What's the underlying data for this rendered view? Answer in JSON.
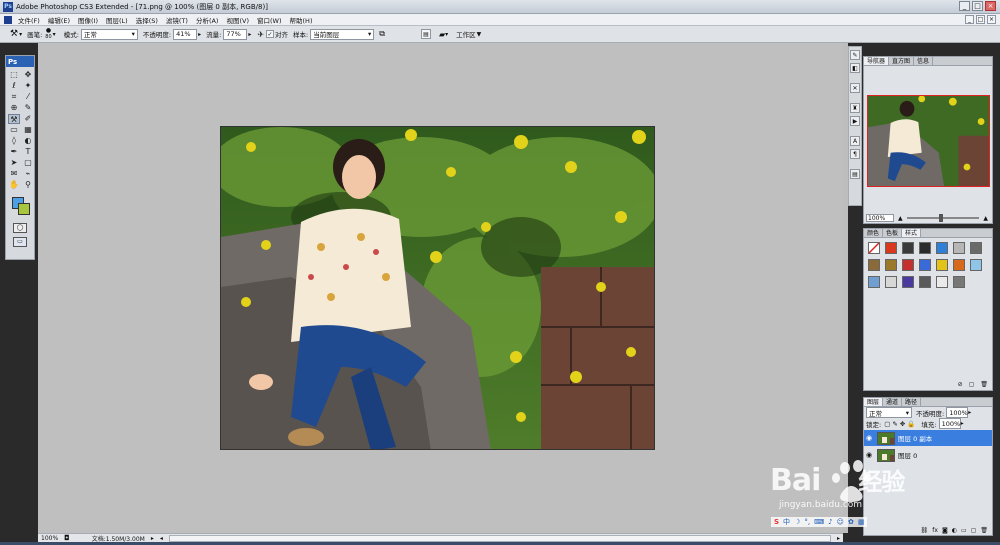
{
  "window": {
    "title": "Adobe Photoshop CS3 Extended - [71.png @ 100% (图层 0 副本, RGB/8)]",
    "app_icon": "Ps",
    "controls": [
      "_",
      "□",
      "×"
    ]
  },
  "menu": {
    "items": [
      "文件(F)",
      "编辑(E)",
      "图像(I)",
      "图层(L)",
      "选择(S)",
      "滤镜(T)",
      "分析(A)",
      "视图(V)",
      "窗口(W)",
      "帮助(H)"
    ],
    "controls": [
      "_",
      "□",
      "×"
    ]
  },
  "options": {
    "brush_label": "画笔:",
    "brush_size": "80",
    "mode_label": "模式:",
    "mode_value": "正常",
    "opacity_label": "不透明度:",
    "opacity_value": "41%",
    "flow_label": "流量:",
    "flow_value": "77%",
    "aligned_label": "对齐",
    "sample_label": "样本:",
    "sample_value": "当前图层",
    "workspace_label": "工作区"
  },
  "toolbox": {
    "header": "Ps",
    "fg_color": "#4d9fe6",
    "bg_color": "#a8c63d"
  },
  "document": {
    "zoom": "100%",
    "doc_size": "文档:1.50M/3.00M"
  },
  "navigator": {
    "tabs": [
      "导航器",
      "直方图",
      "信息"
    ],
    "zoom": "100%"
  },
  "styles": {
    "tabs": [
      "颜色",
      "色板",
      "样式"
    ],
    "swatches": [
      "#f4f4f4",
      "#d8381d",
      "#3a3a3a",
      "#2b2b2b",
      "#2f7fd6",
      "#b7b7b7",
      "#6a6a6a",
      "#8b6a3a",
      "#9a7a2a",
      "#c43030",
      "#3a6ad8",
      "#e3c21a",
      "#d66a1a",
      "#8fc6e8",
      "#6f9fd0",
      "#d7d7d7",
      "#4a3aa0",
      "#5a5a5a",
      "#eaeaea",
      "#777777"
    ]
  },
  "layers": {
    "tabs": [
      "图层",
      "通道",
      "路径"
    ],
    "blend_mode": "正常",
    "opacity_label": "不透明度:",
    "opacity_value": "100%",
    "lock_label": "锁定:",
    "fill_label": "填充:",
    "fill_value": "100%",
    "items": [
      {
        "name": "图层 0 副本",
        "selected": true
      },
      {
        "name": "图层 0",
        "selected": false
      }
    ]
  },
  "watermark": {
    "brand": "Bai",
    "brand2": "经验",
    "url": "jingyan.baidu.com"
  },
  "ime": {
    "label": "中"
  }
}
